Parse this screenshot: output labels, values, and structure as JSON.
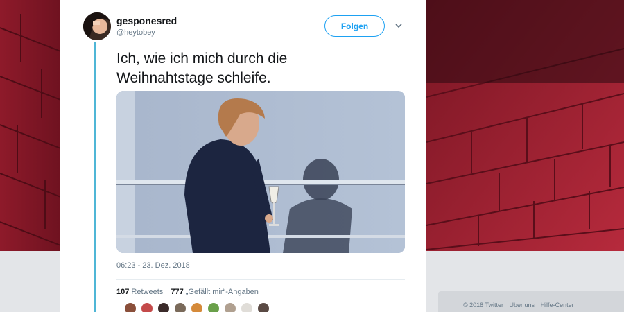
{
  "tweet": {
    "author_name": "gesponesred",
    "author_handle": "@heytobey",
    "follow_label": "Folgen",
    "text_line1": "Ich, wie ich mich durch die",
    "text_line2": "Weihnahtstage schleife.",
    "timestamp": "06:23 - 23. Dez. 2018",
    "retweet_count": "107",
    "retweet_label": "Retweets",
    "like_count": "777",
    "like_label": "„Gefällt mir“-Angaben",
    "liker_colors": [
      "#8a4f3a",
      "#c44a4a",
      "#3b2b2a",
      "#7a6a5a",
      "#d58a3a",
      "#6aa04a",
      "#b0a090",
      "#e0ddd8",
      "#5a4a44"
    ]
  },
  "footer": {
    "copyright": "© 2018 Twitter",
    "about": "Über uns",
    "help": "Hilfe-Center"
  },
  "colors": {
    "accent": "#1da1f2",
    "thread": "#4fb6d6",
    "wall": "#b8283a"
  }
}
